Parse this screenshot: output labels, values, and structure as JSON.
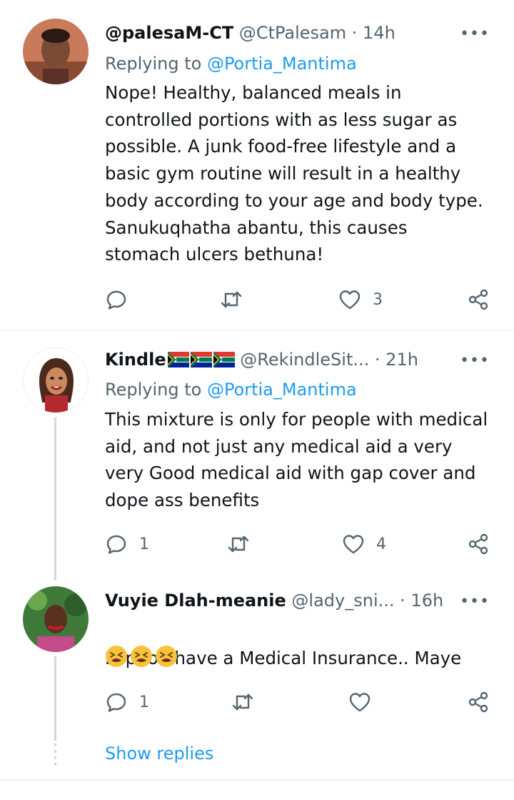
{
  "tweets": [
    {
      "display_name": "@palesaM-CT",
      "handle": "@CtPalesam",
      "separator": "·",
      "time": "14h",
      "replying_to_prefix": "Replying to ",
      "replying_to": "@Portia_Mantima",
      "text": "Nope! Healthy, balanced  meals in\ncontrolled portions with as less sugar as\npossible. A junk food-free lifestyle and a\nbasic gym routine will result in a healthy\nbody according to your age and body type.\nSanukuqhatha abantu, this causes\nstomach ulcers bethuna!",
      "reply_count": "",
      "like_count": "3"
    },
    {
      "display_name": "Kindle",
      "flags": [
        "south-africa-flag",
        "south-africa-flag",
        "south-africa-flag"
      ],
      "handle": "@RekindleSit...",
      "separator": "·",
      "time": "21h",
      "replying_to_prefix": "Replying to ",
      "replying_to": "@Portia_Mantima",
      "text": "This mixture is only for people with medical\naid, and not just any medical aid a very\nvery Good medical aid with gap cover and\ndope ass benefits",
      "reply_count": "1",
      "like_count": "4"
    },
    {
      "display_name": "Vuyie Dlah-meanie",
      "handle": "@lady_sni...",
      "separator": "·",
      "time": "16h",
      "text": "Lapho I have a Medical Insurance.. Maye",
      "emojis": [
        "tired-face-emoji",
        "tired-face-emoji",
        "tired-face-emoji"
      ],
      "reply_count": "1",
      "like_count": ""
    }
  ],
  "more_glyph": "•••",
  "show_replies": "Show replies",
  "colors": {
    "text": "#0f1419",
    "secondary": "#536471",
    "link": "#1d9bf0",
    "divider": "#eff3f4"
  }
}
